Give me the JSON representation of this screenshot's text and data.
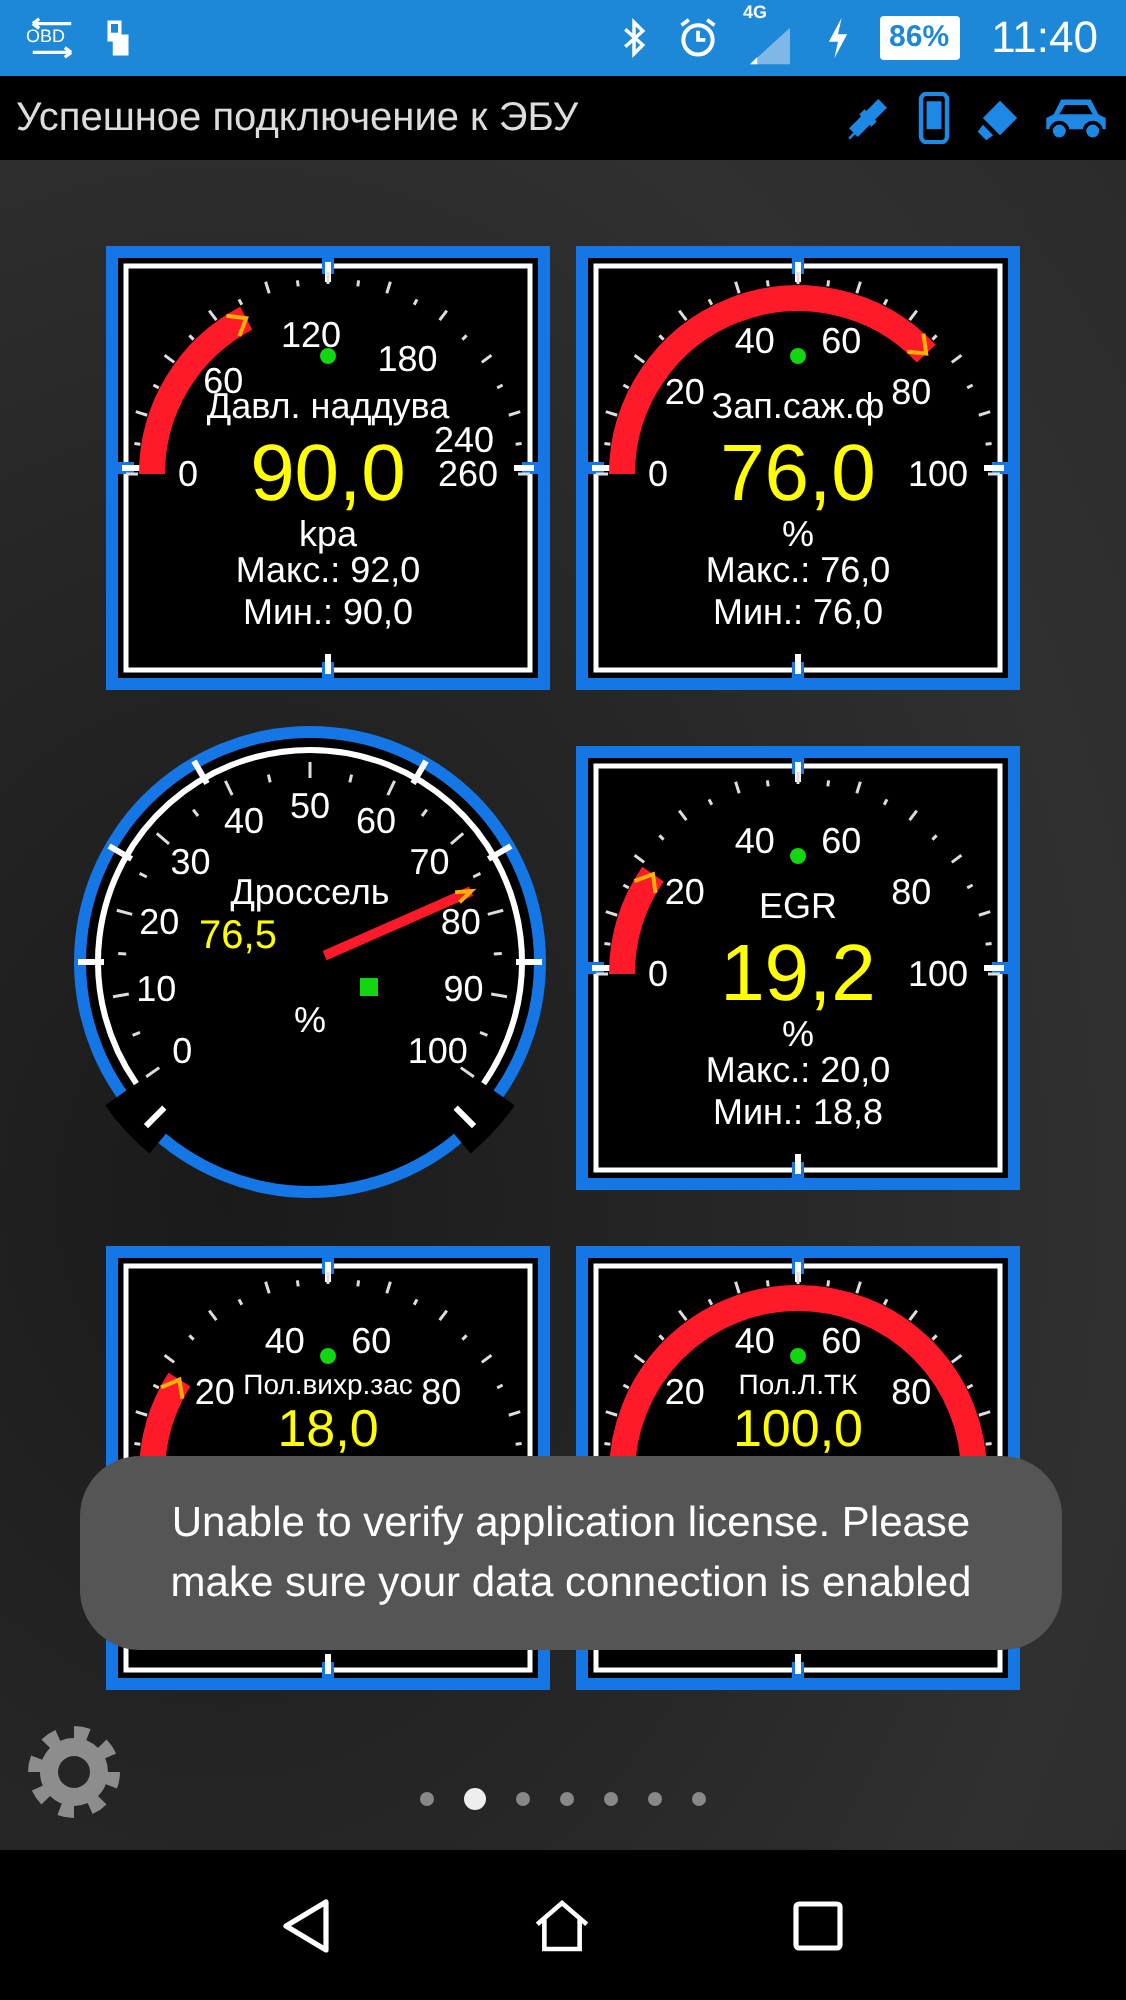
{
  "status_bar": {
    "obd_label": "OBD",
    "network": "4G",
    "battery": "86%",
    "time": "11:40"
  },
  "title_bar": {
    "title": "Успешное подключение к ЭБУ"
  },
  "gauges": [
    {
      "kind": "square",
      "label": "Давл. наддува",
      "value": "90,0",
      "unit": "kpa",
      "max": "Макс.: 92,0",
      "min": "Мин.: 90,0",
      "ticks": [
        "120",
        "180",
        "60",
        "240",
        "0",
        "260"
      ]
    },
    {
      "kind": "square",
      "label": "Зап.саж.ф",
      "value": "76,0",
      "unit": "%",
      "max": "Макс.: 76,0",
      "min": "Мин.: 76,0",
      "ticks": [
        "40",
        "60",
        "20",
        "80",
        "0",
        "100"
      ]
    },
    {
      "kind": "round",
      "label": "Дроссель",
      "value": "76,5",
      "unit": "%",
      "ticks": [
        "50",
        "40",
        "60",
        "30",
        "70",
        "20",
        "80",
        "10",
        "90",
        "0",
        "100"
      ]
    },
    {
      "kind": "square",
      "label": "EGR",
      "value": "19,2",
      "unit": "%",
      "max": "Макс.: 20,0",
      "min": "Мин.: 18,8",
      "ticks": [
        "40",
        "60",
        "20",
        "80",
        "0",
        "100"
      ]
    },
    {
      "kind": "square",
      "label": "Пол.вихр.зас",
      "value": "18,0",
      "ticks": [
        "40",
        "60",
        "20",
        "80"
      ]
    },
    {
      "kind": "square",
      "label": "Пол.Л.ТК",
      "value": "100,0",
      "ticks": [
        "40",
        "60",
        "20",
        "80"
      ]
    }
  ],
  "pages": [
    {
      "selected": false
    },
    {
      "selected": true
    },
    {
      "selected": false
    },
    {
      "selected": false
    },
    {
      "selected": false
    },
    {
      "selected": false
    },
    {
      "selected": false
    }
  ],
  "toast": {
    "message": "Unable to verify application license. Please make sure your data connection is enabled"
  }
}
